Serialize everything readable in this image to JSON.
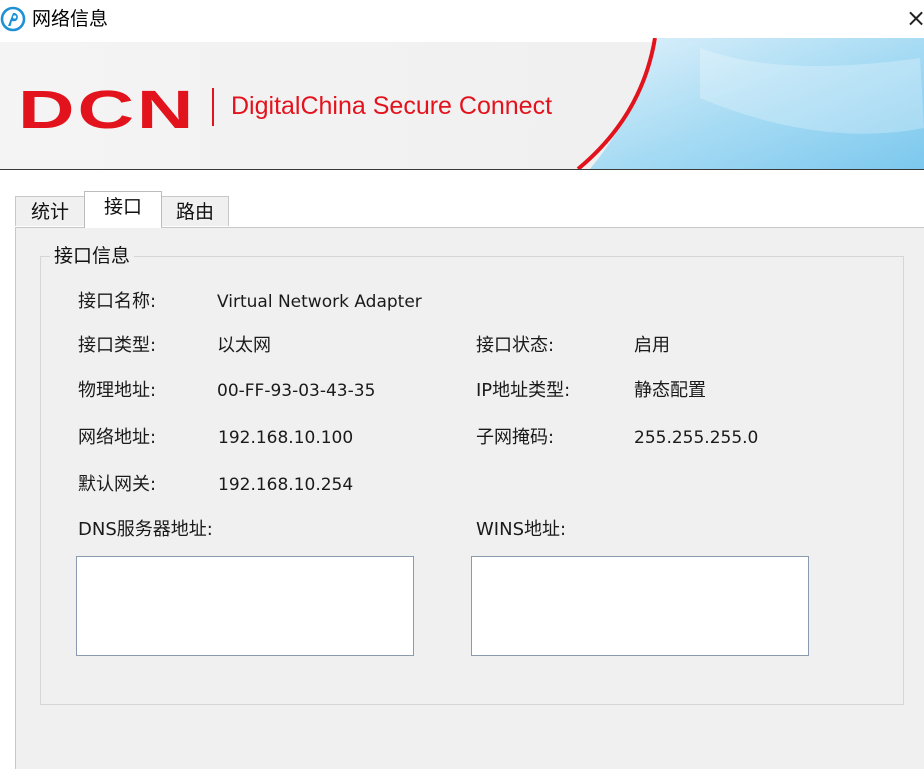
{
  "window": {
    "title": "网络信息",
    "close_glyph": "×"
  },
  "banner": {
    "logo": "DCN",
    "brand": "DigitalChina Secure Connect",
    "brand_color": "#e3131d"
  },
  "tabs": [
    {
      "label": "统计",
      "active": false
    },
    {
      "label": "接口",
      "active": true
    },
    {
      "label": "路由",
      "active": false
    }
  ],
  "interface_info": {
    "group_title": "接口信息",
    "name_label": "接口名称:",
    "name_value": "Virtual Network Adapter",
    "type_label": "接口类型:",
    "type_value": "以太网",
    "status_label": "接口状态:",
    "status_value": "启用",
    "mac_label": "物理地址:",
    "mac_value": "00-FF-93-03-43-35",
    "ip_type_label": "IP地址类型:",
    "ip_type_value": "静态配置",
    "ip_label": "网络地址:",
    "ip_value": "192.168.10.100",
    "mask_label": "子网掩码:",
    "mask_value": "255.255.255.0",
    "gateway_label": "默认网关:",
    "gateway_value": "192.168.10.254",
    "dns_label": "DNS服务器地址:",
    "wins_label": "WINS地址:"
  }
}
